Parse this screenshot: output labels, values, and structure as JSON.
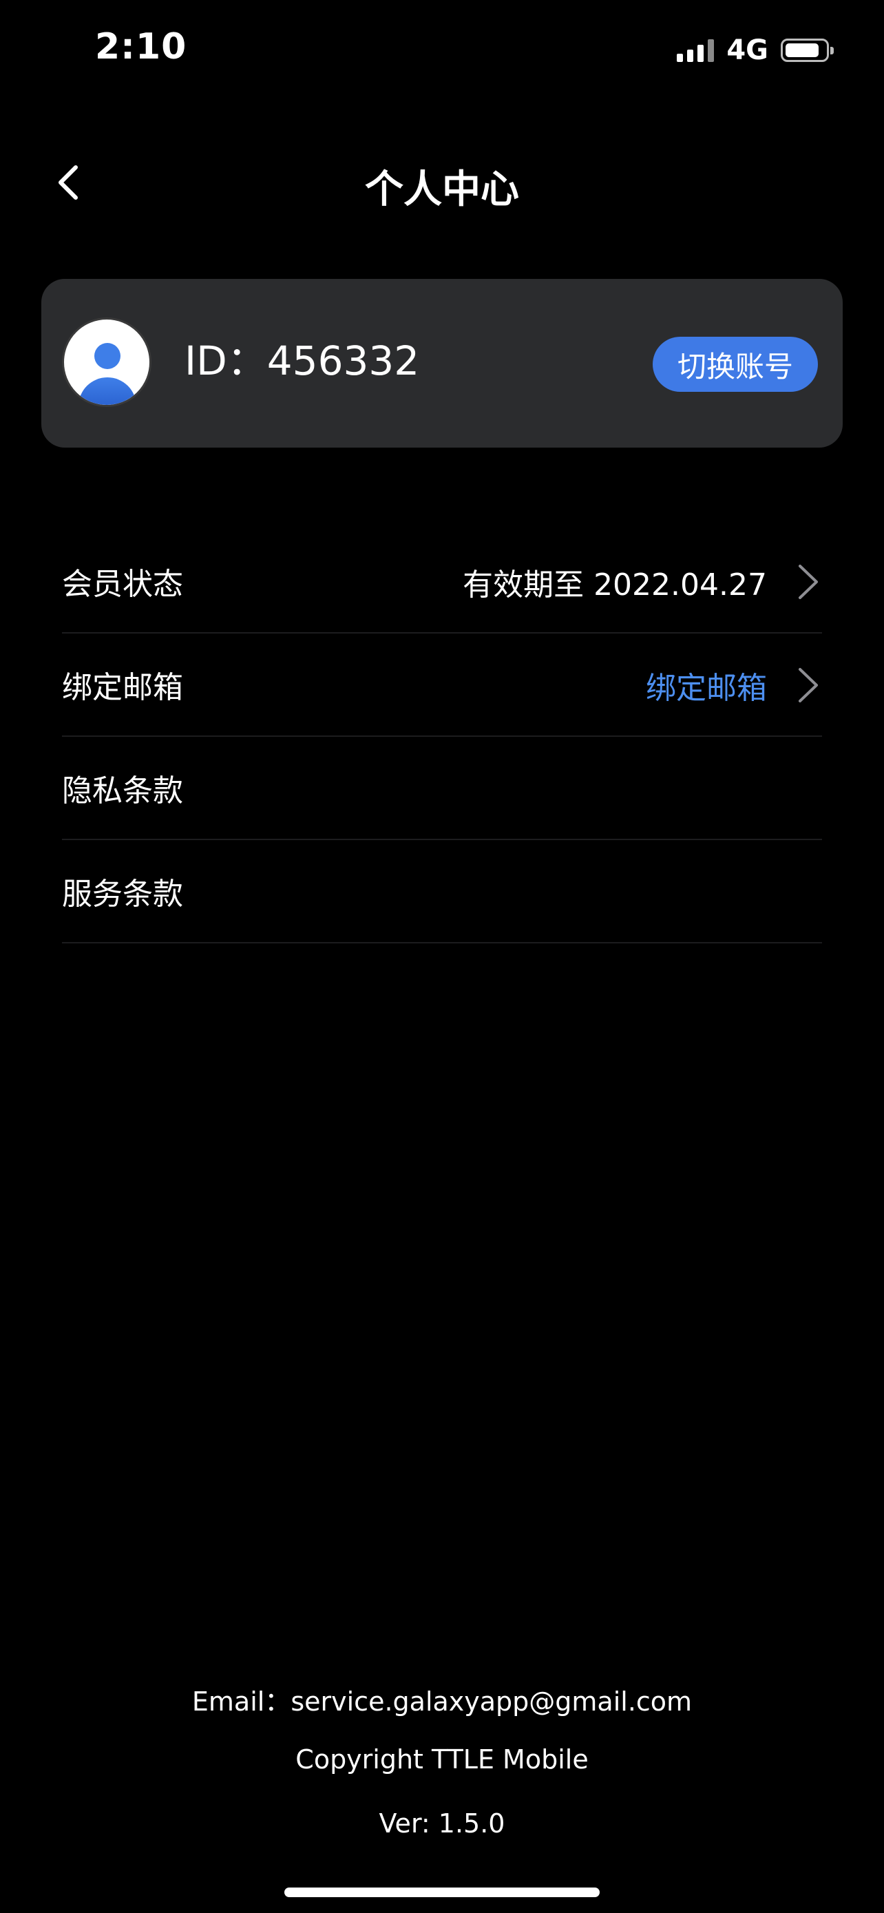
{
  "status_bar": {
    "time": "2:10",
    "network": "4G",
    "battery_level": 0.85
  },
  "nav": {
    "title": "个人中心"
  },
  "profile": {
    "id_text": "ID：456332",
    "switch_account_label": "切换账号"
  },
  "settings": {
    "items": [
      {
        "label": "会员状态",
        "value": "有效期至 2022.04.27"
      },
      {
        "label": "绑定邮箱",
        "value": "绑定邮箱"
      },
      {
        "label": "隐私条款"
      },
      {
        "label": "服务条款"
      }
    ]
  },
  "footer": {
    "email": "Email：service.galaxyapp@gmail.com",
    "copyright": "Copyright TTLE Mobile",
    "version": "Ver: 1.5.0"
  },
  "colors": {
    "accent": "#3f7ae6",
    "link": "#4d8ff0",
    "card_bg": "#2b2c2e",
    "page_bg": "#000000"
  }
}
